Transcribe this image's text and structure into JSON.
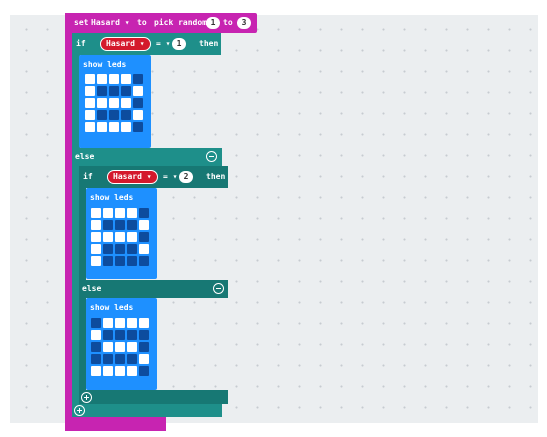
{
  "set_block": {
    "set_label": "set",
    "variable": "Hasard ▾",
    "to_label": "to",
    "pick_label": "pick random",
    "from": "1",
    "to_word": "to",
    "upto": "3"
  },
  "if1": {
    "if_label": "if",
    "variable": "Hasard ▾",
    "op": "= ▾",
    "value": "1",
    "then_label": "then",
    "show_leds": "show leds",
    "leds": [
      [
        1,
        1,
        1,
        1,
        0
      ],
      [
        1,
        0,
        0,
        0,
        1
      ],
      [
        1,
        1,
        1,
        1,
        0
      ],
      [
        1,
        0,
        0,
        0,
        1
      ],
      [
        1,
        1,
        1,
        1,
        0
      ]
    ]
  },
  "else1": {
    "else_label": "else"
  },
  "if2": {
    "if_label": "if",
    "variable": "Hasard ▾",
    "op": "= ▾",
    "value": "2",
    "then_label": "then",
    "show_leds": "show leds",
    "leds": [
      [
        1,
        1,
        1,
        1,
        0
      ],
      [
        1,
        0,
        0,
        0,
        1
      ],
      [
        1,
        1,
        1,
        1,
        0
      ],
      [
        1,
        0,
        0,
        0,
        1
      ],
      [
        1,
        0,
        0,
        0,
        0
      ]
    ]
  },
  "else2": {
    "else_label": "else",
    "show_leds": "show leds",
    "leds": [
      [
        0,
        1,
        1,
        1,
        1
      ],
      [
        1,
        0,
        0,
        0,
        0
      ],
      [
        0,
        1,
        1,
        1,
        0
      ],
      [
        0,
        0,
        0,
        0,
        1
      ],
      [
        1,
        1,
        1,
        1,
        0
      ]
    ]
  },
  "colors": {
    "variables": "#c724b1",
    "logic": "#1e8f8a",
    "basic": "#1e90ff",
    "variable_pill": "#d4192c",
    "workspace": "#ebeef0"
  }
}
